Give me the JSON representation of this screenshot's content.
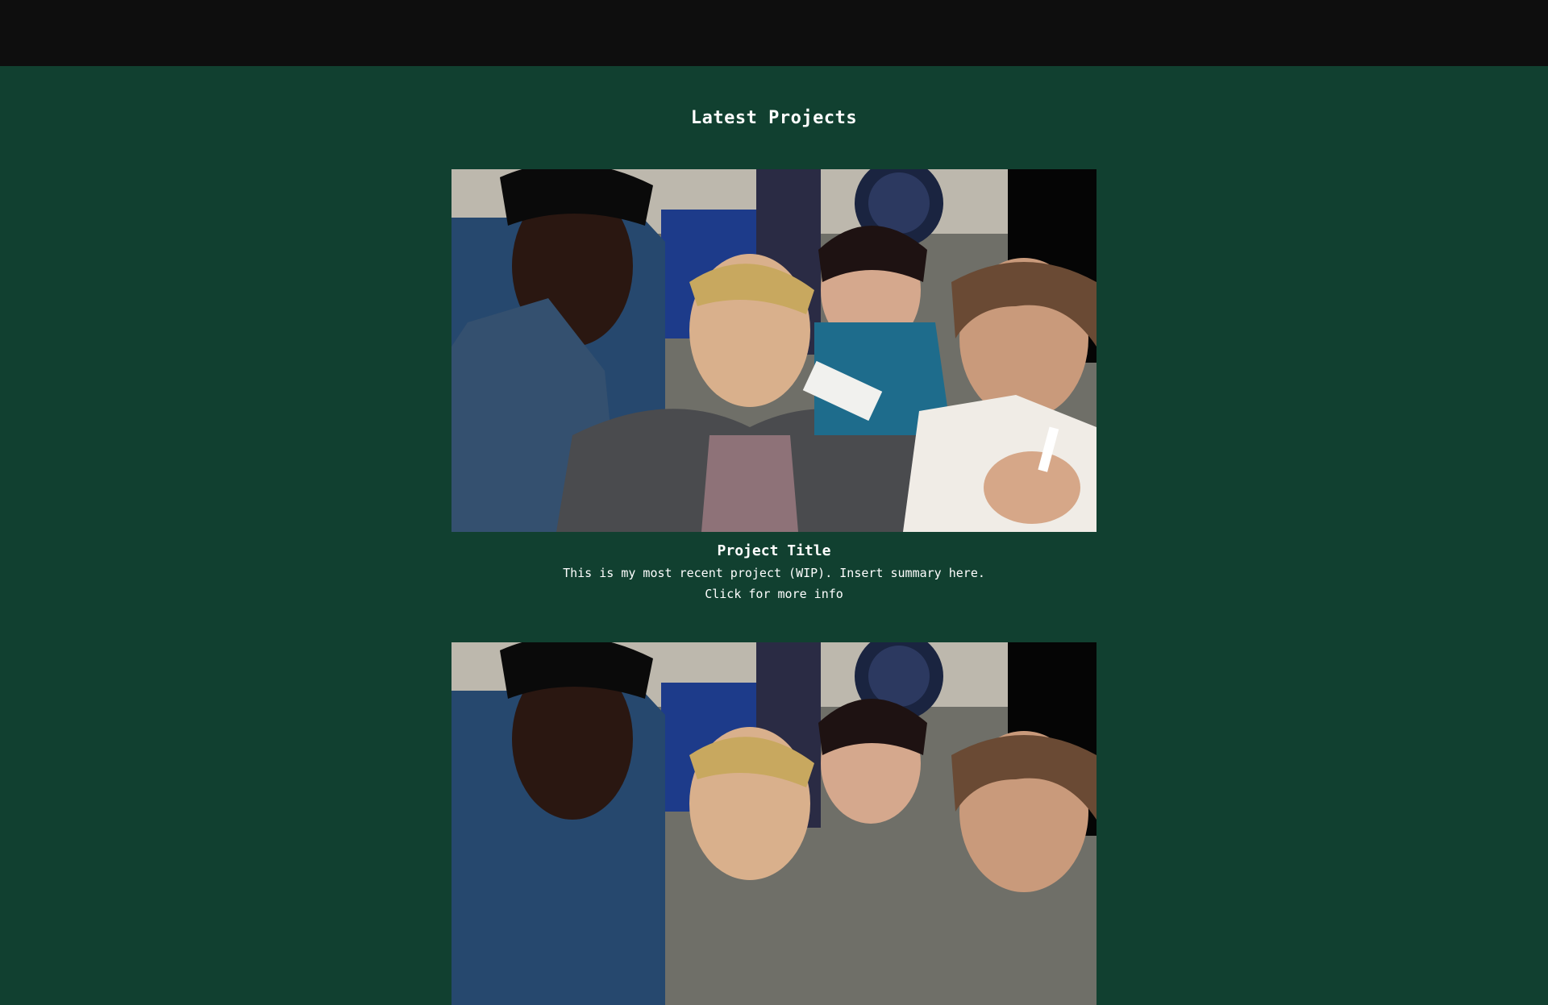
{
  "header": {},
  "projects_section": {
    "title": "Latest Projects",
    "projects": [
      {
        "title": "Project Title",
        "summary": "This is my most recent project (WIP). Insert summary here.",
        "link_text": "Click for more info"
      },
      {
        "title": "",
        "summary": "",
        "link_text": ""
      }
    ]
  },
  "colors": {
    "topbar": "#0e0e0e",
    "background": "#114030",
    "text": "#ffffff"
  }
}
